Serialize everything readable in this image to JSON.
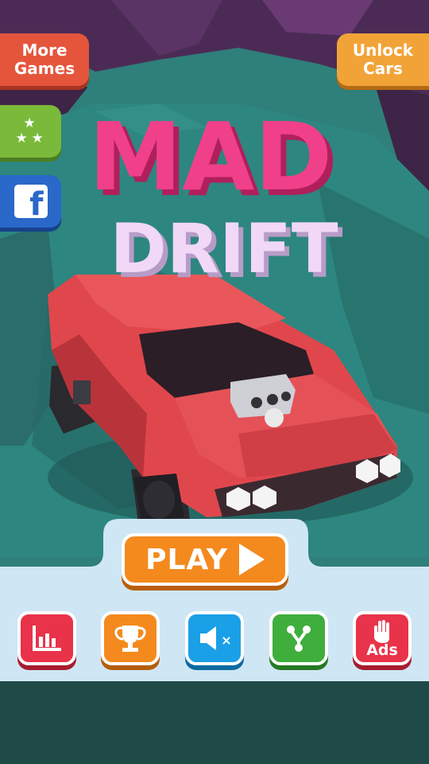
{
  "left_buttons": {
    "more_games": "More\nGames",
    "rate_icon": "stars-icon",
    "facebook_icon": "facebook-icon",
    "facebook_glyph": "f"
  },
  "right_buttons": {
    "unlock_cars": "Unlock\nCars"
  },
  "title": {
    "line1": "MAD",
    "line2": "DRIFT"
  },
  "play": {
    "label": "PLAY",
    "icon": "play-triangle-icon"
  },
  "bottom_buttons": [
    {
      "icon": "leaderboard-icon"
    },
    {
      "icon": "trophy-icon"
    },
    {
      "icon": "sound-muted-icon",
      "glyph": "×"
    },
    {
      "icon": "share-icon"
    },
    {
      "icon": "no-ads-hand-icon",
      "label": "Ads"
    }
  ],
  "colors": {
    "sky": "#4b2b55",
    "ground": "#2f7f7a",
    "panel": "#cfe6f4",
    "footer": "#1f4a47",
    "car": "#e0474c",
    "title_pink": "#f0408a",
    "title_lilac": "#f0d8f6"
  }
}
